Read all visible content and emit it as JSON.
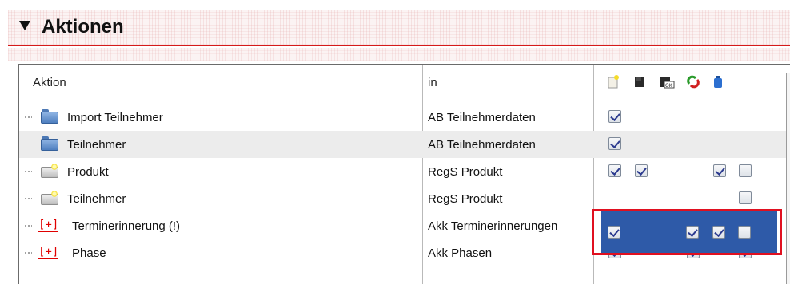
{
  "panel": {
    "title": "Aktionen"
  },
  "table": {
    "headers": {
      "aktion": "Aktion",
      "in": "in"
    },
    "header_icons": [
      "new-document-icon",
      "save-icon",
      "save-ok-icon",
      "refresh-icon",
      "bottle-icon"
    ],
    "rows": [
      {
        "name": "Import Teilnehmer",
        "icon": "blue-folder-icon",
        "in": "AB Teilnehmerdaten",
        "checks": [
          true,
          null,
          null,
          null,
          null
        ]
      },
      {
        "name": "Teilnehmer",
        "icon": "blue-folder-icon",
        "in": "AB Teilnehmerdaten",
        "checks": [
          true,
          null,
          null,
          null,
          null
        ]
      },
      {
        "name": "Produkt",
        "icon": "new-folder-icon",
        "in": "RegS Produkt",
        "checks": [
          true,
          true,
          null,
          true,
          false
        ]
      },
      {
        "name": "Teilnehmer",
        "icon": "new-folder-icon",
        "in": "RegS Produkt",
        "checks": [
          null,
          null,
          null,
          null,
          false
        ]
      },
      {
        "name": "Terminerinnerung (!)",
        "icon": "expand-plus-icon",
        "expand_label": "[+]",
        "in": "Akk Terminerinnerungen",
        "checks": [
          true,
          null,
          true,
          true,
          false
        ]
      },
      {
        "name": "Phase",
        "icon": "expand-plus-icon",
        "expand_label": "[+]",
        "in": "Akk Phasen",
        "checks": [
          true,
          null,
          true,
          null,
          true
        ]
      }
    ]
  },
  "colors": {
    "header_rule": "#d51b1b",
    "selection": "#2e5aa8",
    "highlight_box": "#e01020"
  }
}
